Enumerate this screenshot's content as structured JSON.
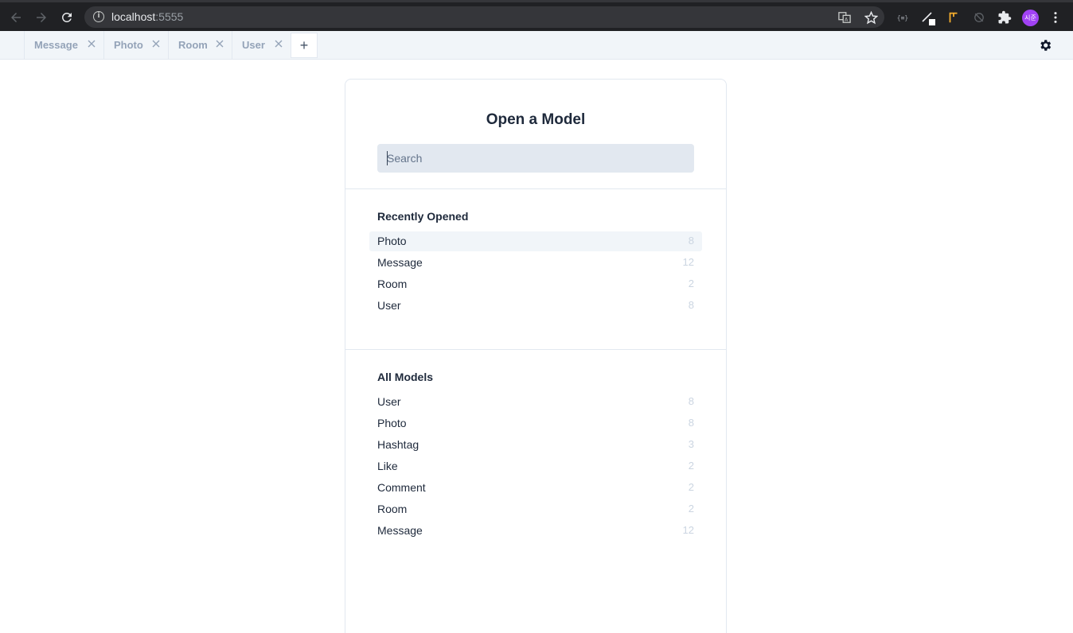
{
  "browser": {
    "url_host": "localhost",
    "url_port": ":5555",
    "avatar_text": "시준",
    "extension_text": "{≡}",
    "icons": [
      "back-arrow-icon",
      "forward-arrow-icon",
      "reload-icon",
      "info-icon",
      "translate-icon",
      "star-icon",
      "extension-icon",
      "puzzle-icon",
      "kebab-menu-icon"
    ]
  },
  "tabs": [
    {
      "label": "Message"
    },
    {
      "label": "Photo"
    },
    {
      "label": "Room"
    },
    {
      "label": "User"
    }
  ],
  "add_tab_label": "+",
  "modal": {
    "title": "Open a Model",
    "search_placeholder": "Search",
    "recent": {
      "title": "Recently Opened",
      "items": [
        {
          "name": "Photo",
          "count": "8"
        },
        {
          "name": "Message",
          "count": "12"
        },
        {
          "name": "Room",
          "count": "2"
        },
        {
          "name": "User",
          "count": "8"
        }
      ]
    },
    "all": {
      "title": "All Models",
      "items": [
        {
          "name": "User",
          "count": "8"
        },
        {
          "name": "Photo",
          "count": "8"
        },
        {
          "name": "Hashtag",
          "count": "3"
        },
        {
          "name": "Like",
          "count": "2"
        },
        {
          "name": "Comment",
          "count": "2"
        },
        {
          "name": "Room",
          "count": "2"
        },
        {
          "name": "Message",
          "count": "12"
        }
      ]
    }
  },
  "colors": {
    "browser_bg": "#202124",
    "tabstrip_bg": "#f1f5f9",
    "search_bg": "#e2e8f0",
    "highlight_bg": "#f1f5f9",
    "count_text": "#cbd5e1",
    "avatar_bg": "#a142f4"
  }
}
